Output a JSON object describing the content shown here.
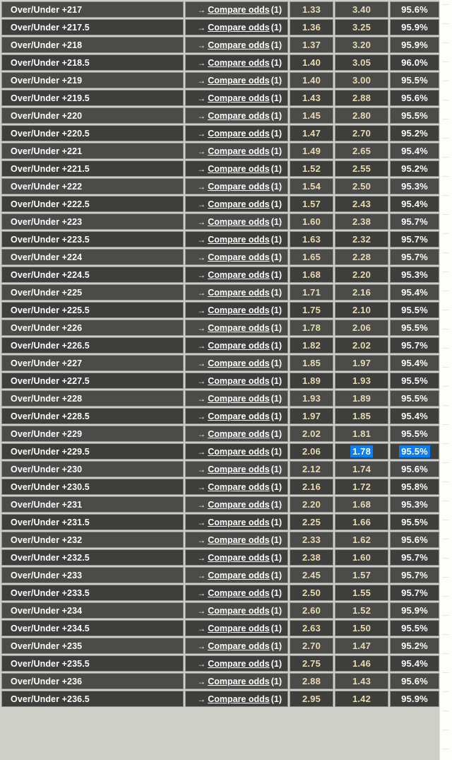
{
  "panel": {
    "name": "over-under-odds-table",
    "accent_selection_color": "#0b7ef2",
    "odds_text_color": "#e9dcb2",
    "row_color_a": "#4b4b49",
    "row_color_b": "#3e3e3c"
  },
  "labels": {
    "compare_link": "Compare odds",
    "compare_count": "(1)",
    "arrow_icon": "→"
  },
  "rows": [
    {
      "label": "Over/Under +217",
      "odd1": "1.33",
      "odd2": "3.40",
      "payout": "95.6%"
    },
    {
      "label": "Over/Under +217.5",
      "odd1": "1.36",
      "odd2": "3.25",
      "payout": "95.9%"
    },
    {
      "label": "Over/Under +218",
      "odd1": "1.37",
      "odd2": "3.20",
      "payout": "95.9%"
    },
    {
      "label": "Over/Under +218.5",
      "odd1": "1.40",
      "odd2": "3.05",
      "payout": "96.0%"
    },
    {
      "label": "Over/Under +219",
      "odd1": "1.40",
      "odd2": "3.00",
      "payout": "95.5%"
    },
    {
      "label": "Over/Under +219.5",
      "odd1": "1.43",
      "odd2": "2.88",
      "payout": "95.6%"
    },
    {
      "label": "Over/Under +220",
      "odd1": "1.45",
      "odd2": "2.80",
      "payout": "95.5%"
    },
    {
      "label": "Over/Under +220.5",
      "odd1": "1.47",
      "odd2": "2.70",
      "payout": "95.2%"
    },
    {
      "label": "Over/Under +221",
      "odd1": "1.49",
      "odd2": "2.65",
      "payout": "95.4%"
    },
    {
      "label": "Over/Under +221.5",
      "odd1": "1.52",
      "odd2": "2.55",
      "payout": "95.2%"
    },
    {
      "label": "Over/Under +222",
      "odd1": "1.54",
      "odd2": "2.50",
      "payout": "95.3%"
    },
    {
      "label": "Over/Under +222.5",
      "odd1": "1.57",
      "odd2": "2.43",
      "payout": "95.4%"
    },
    {
      "label": "Over/Under +223",
      "odd1": "1.60",
      "odd2": "2.38",
      "payout": "95.7%"
    },
    {
      "label": "Over/Under +223.5",
      "odd1": "1.63",
      "odd2": "2.32",
      "payout": "95.7%"
    },
    {
      "label": "Over/Under +224",
      "odd1": "1.65",
      "odd2": "2.28",
      "payout": "95.7%"
    },
    {
      "label": "Over/Under +224.5",
      "odd1": "1.68",
      "odd2": "2.20",
      "payout": "95.3%"
    },
    {
      "label": "Over/Under +225",
      "odd1": "1.71",
      "odd2": "2.16",
      "payout": "95.4%"
    },
    {
      "label": "Over/Under +225.5",
      "odd1": "1.75",
      "odd2": "2.10",
      "payout": "95.5%"
    },
    {
      "label": "Over/Under +226",
      "odd1": "1.78",
      "odd2": "2.06",
      "payout": "95.5%"
    },
    {
      "label": "Over/Under +226.5",
      "odd1": "1.82",
      "odd2": "2.02",
      "payout": "95.7%"
    },
    {
      "label": "Over/Under +227",
      "odd1": "1.85",
      "odd2": "1.97",
      "payout": "95.4%"
    },
    {
      "label": "Over/Under +227.5",
      "odd1": "1.89",
      "odd2": "1.93",
      "payout": "95.5%"
    },
    {
      "label": "Over/Under +228",
      "odd1": "1.93",
      "odd2": "1.89",
      "payout": "95.5%"
    },
    {
      "label": "Over/Under +228.5",
      "odd1": "1.97",
      "odd2": "1.85",
      "payout": "95.4%"
    },
    {
      "label": "Over/Under +229",
      "odd1": "2.02",
      "odd2": "1.81",
      "payout": "95.5%"
    },
    {
      "label": "Over/Under +229.5",
      "odd1": "2.06",
      "odd2": "1.78",
      "payout": "95.5%",
      "selected": [
        "odd2",
        "payout"
      ]
    },
    {
      "label": "Over/Under +230",
      "odd1": "2.12",
      "odd2": "1.74",
      "payout": "95.6%"
    },
    {
      "label": "Over/Under +230.5",
      "odd1": "2.16",
      "odd2": "1.72",
      "payout": "95.8%"
    },
    {
      "label": "Over/Under +231",
      "odd1": "2.20",
      "odd2": "1.68",
      "payout": "95.3%"
    },
    {
      "label": "Over/Under +231.5",
      "odd1": "2.25",
      "odd2": "1.66",
      "payout": "95.5%"
    },
    {
      "label": "Over/Under +232",
      "odd1": "2.33",
      "odd2": "1.62",
      "payout": "95.6%"
    },
    {
      "label": "Over/Under +232.5",
      "odd1": "2.38",
      "odd2": "1.60",
      "payout": "95.7%"
    },
    {
      "label": "Over/Under +233",
      "odd1": "2.45",
      "odd2": "1.57",
      "payout": "95.7%"
    },
    {
      "label": "Over/Under +233.5",
      "odd1": "2.50",
      "odd2": "1.55",
      "payout": "95.7%"
    },
    {
      "label": "Over/Under +234",
      "odd1": "2.60",
      "odd2": "1.52",
      "payout": "95.9%"
    },
    {
      "label": "Over/Under +234.5",
      "odd1": "2.63",
      "odd2": "1.50",
      "payout": "95.5%"
    },
    {
      "label": "Over/Under +235",
      "odd1": "2.70",
      "odd2": "1.47",
      "payout": "95.2%"
    },
    {
      "label": "Over/Under +235.5",
      "odd1": "2.75",
      "odd2": "1.46",
      "payout": "95.4%"
    },
    {
      "label": "Over/Under +236",
      "odd1": "2.88",
      "odd2": "1.43",
      "payout": "95.6%"
    },
    {
      "label": "Over/Under +236.5",
      "odd1": "2.95",
      "odd2": "1.42",
      "payout": "95.9%"
    }
  ]
}
